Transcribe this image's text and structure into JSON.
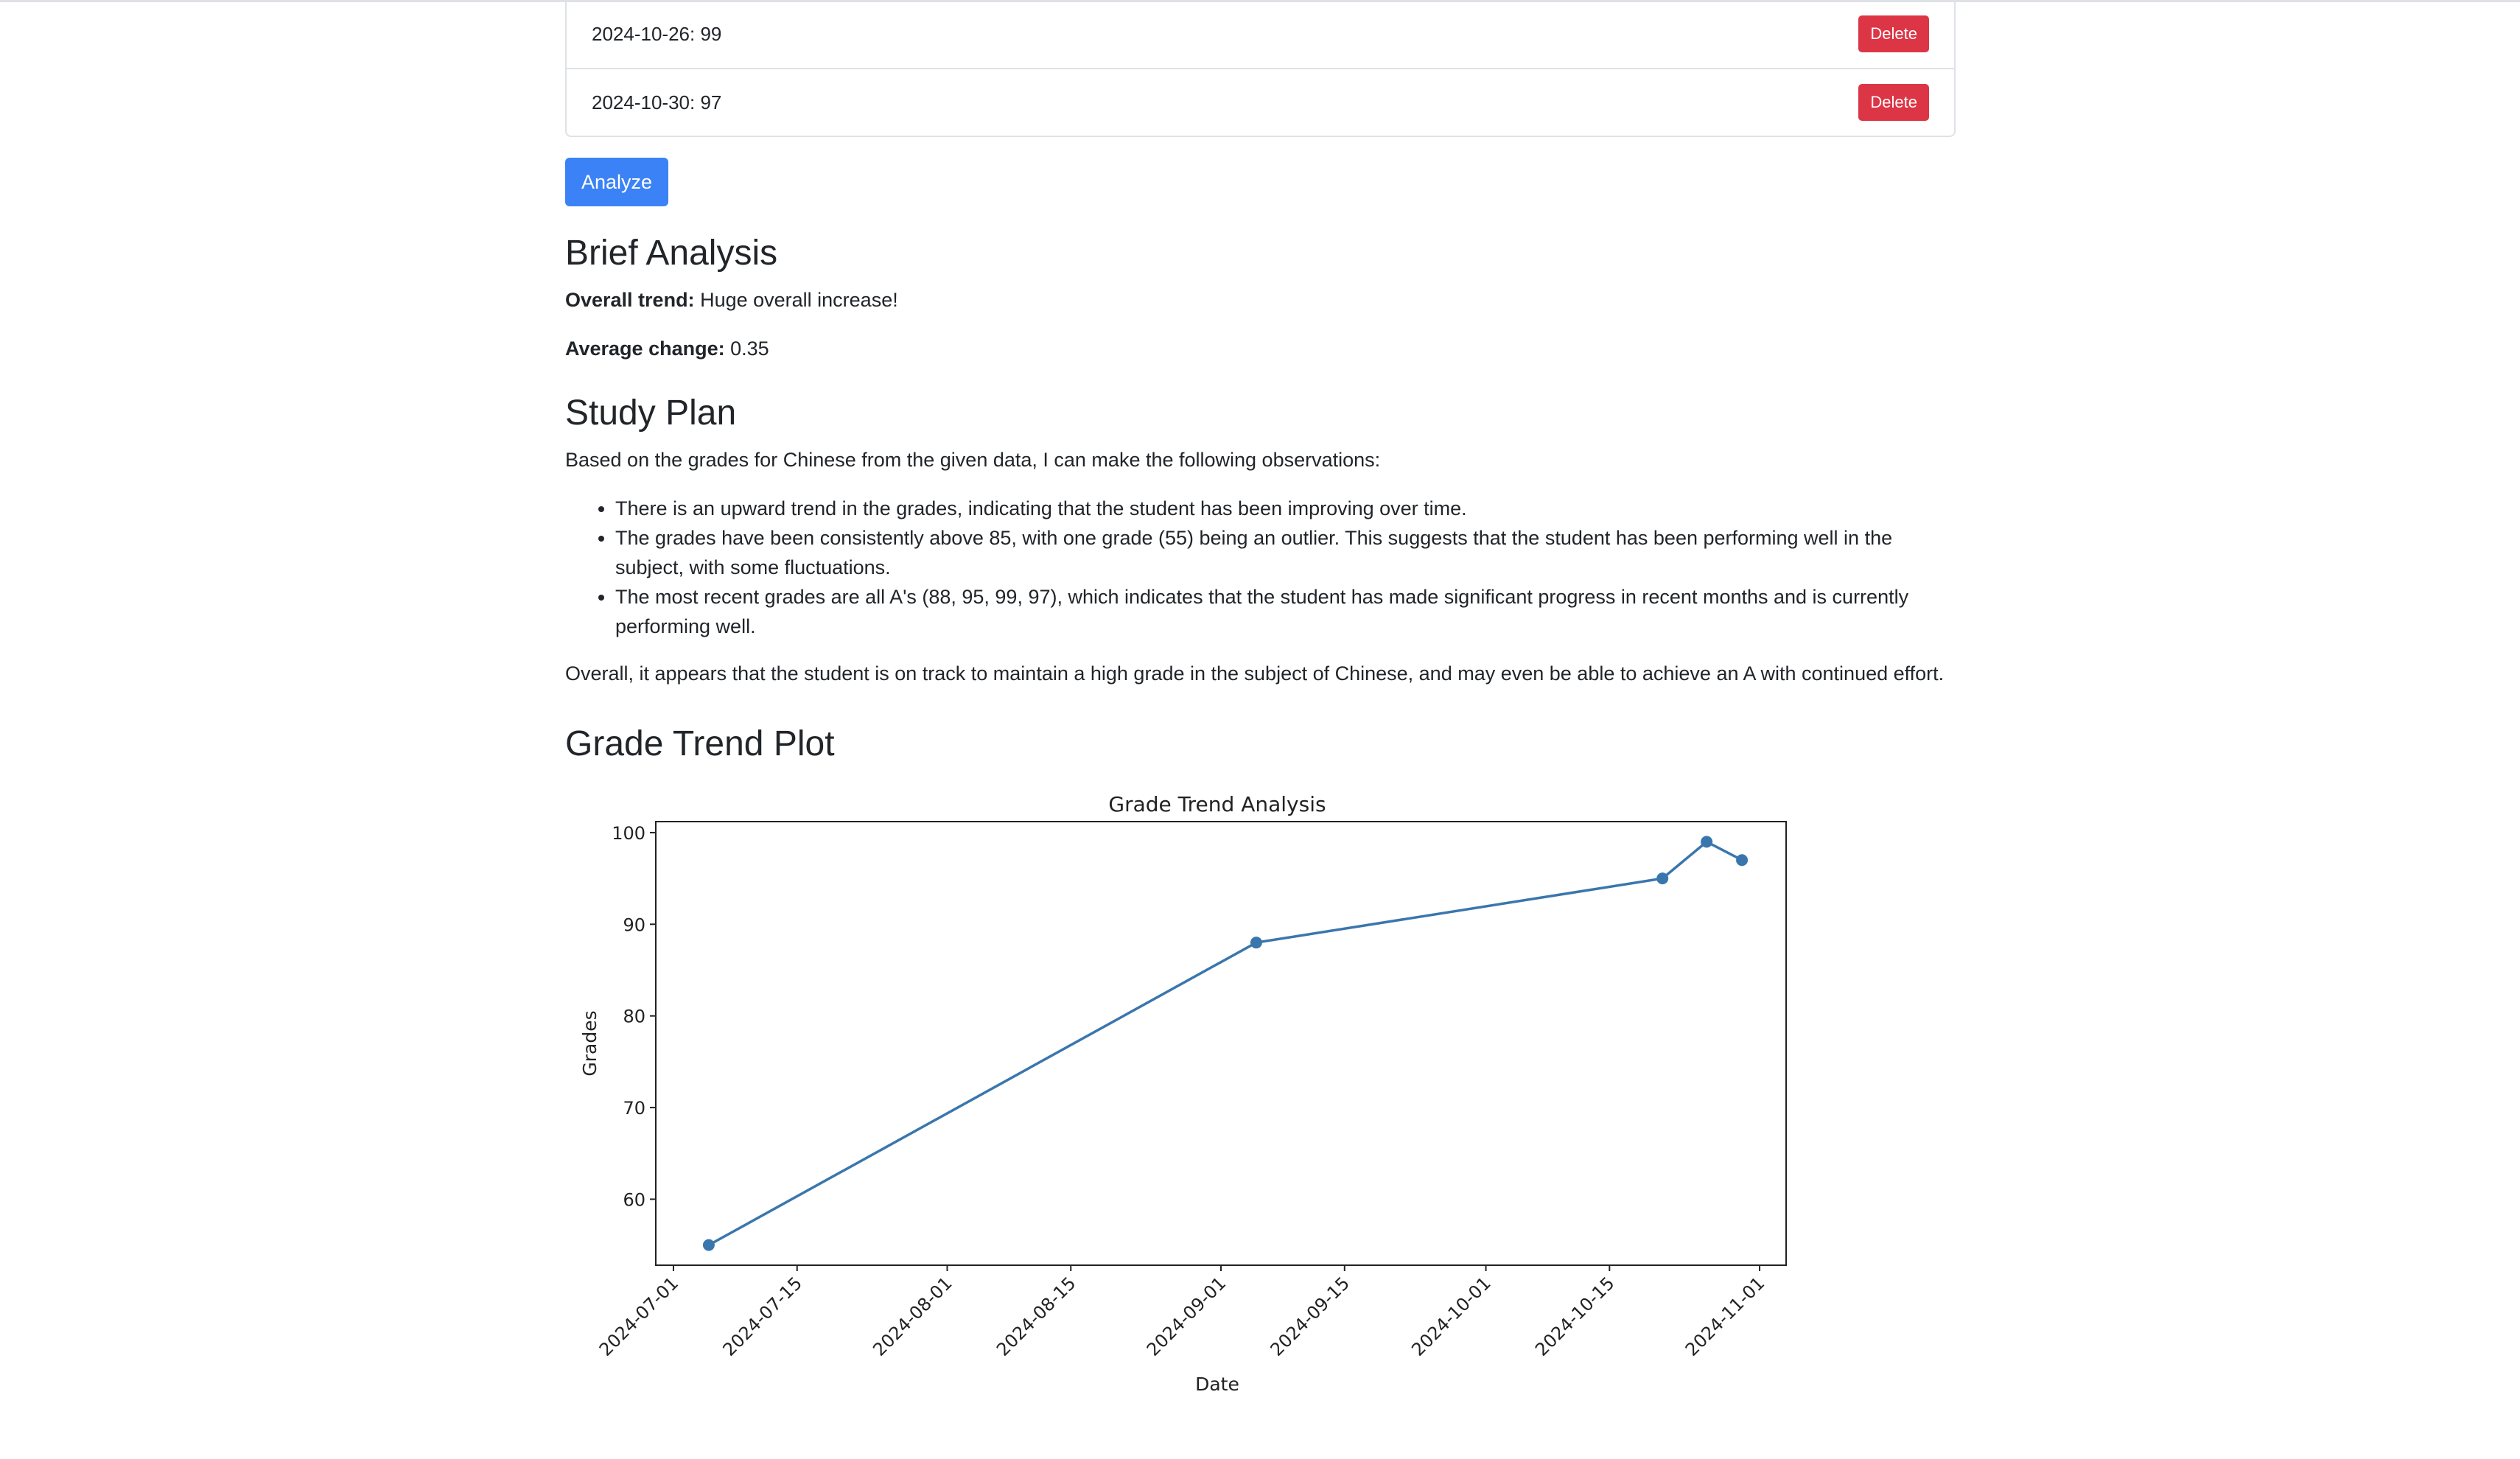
{
  "grades_list": [
    {
      "text": "2024-10-26: 99",
      "delete_label": "Delete"
    },
    {
      "text": "2024-10-30: 97",
      "delete_label": "Delete"
    }
  ],
  "analyze_label": "Analyze",
  "brief": {
    "heading": "Brief Analysis",
    "trend_label": "Overall trend:",
    "trend_value": "Huge overall increase!",
    "change_label": "Average change:",
    "change_value": "0.35"
  },
  "study_plan": {
    "heading": "Study Plan",
    "intro": "Based on the grades for Chinese from the given data, I can make the following observations:",
    "bullets": [
      "There is an upward trend in the grades, indicating that the student has been improving over time.",
      "The grades have been consistently above 85, with one grade (55) being an outlier. This suggests that the student has been performing well in the subject, with some fluctuations.",
      "The most recent grades are all A's (88, 95, 99, 97), which indicates that the student has made significant progress in recent months and is currently performing well."
    ],
    "conclusion": "Overall, it appears that the student is on track to maintain a high grade in the subject of Chinese, and may even be able to achieve an A with continued effort."
  },
  "plot": {
    "heading": "Grade Trend Plot"
  },
  "chart_data": {
    "type": "line",
    "title": "Grade Trend Analysis",
    "xlabel": "Date",
    "ylabel": "Grades",
    "x": [
      "2024-07-05",
      "2024-09-05",
      "2024-10-21",
      "2024-10-26",
      "2024-10-30"
    ],
    "y": [
      55,
      88,
      95,
      99,
      97
    ],
    "xlim": [
      "2024-06-29",
      "2024-11-04"
    ],
    "ylim": [
      52.8,
      101.2
    ],
    "x_ticks": [
      "2024-07-01",
      "2024-07-15",
      "2024-08-01",
      "2024-08-15",
      "2024-09-01",
      "2024-09-15",
      "2024-10-01",
      "2024-10-15",
      "2024-11-01"
    ],
    "y_ticks": [
      60,
      70,
      80,
      90,
      100
    ],
    "color": "#3a76ae",
    "grid": false,
    "legend": false
  }
}
